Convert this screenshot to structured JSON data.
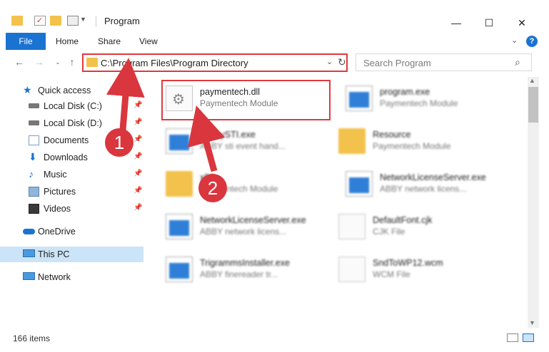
{
  "window": {
    "title": "Program"
  },
  "window_controls": {
    "minimize": "—",
    "maximize": "☐",
    "close": "✕"
  },
  "ribbon": {
    "tabs": [
      "File",
      "Home",
      "Share",
      "View"
    ],
    "help": "?"
  },
  "address_bar": {
    "path": "C:\\Program Files\\Program Directory"
  },
  "search": {
    "placeholder": "Search Program"
  },
  "sidebar": {
    "items": [
      {
        "label": "Quick access",
        "icon": "star-icon",
        "pinned": false
      },
      {
        "label": "Local Disk (C:)",
        "icon": "drive-icon",
        "pinned": true
      },
      {
        "label": "Local Disk (D:)",
        "icon": "drive-icon",
        "pinned": true
      },
      {
        "label": "Documents",
        "icon": "documents-icon",
        "pinned": true
      },
      {
        "label": "Downloads",
        "icon": "download-icon",
        "pinned": true
      },
      {
        "label": "Music",
        "icon": "music-icon",
        "pinned": true
      },
      {
        "label": "Pictures",
        "icon": "pictures-icon",
        "pinned": true
      },
      {
        "label": "Videos",
        "icon": "videos-icon",
        "pinned": true
      },
      {
        "label": "OneDrive",
        "icon": "cloud-icon",
        "pinned": false
      },
      {
        "label": "This PC",
        "icon": "computer-icon",
        "pinned": false,
        "selected": true
      },
      {
        "label": "Network",
        "icon": "network-icon",
        "pinned": false
      }
    ]
  },
  "files": [
    {
      "name": "paymentech.dll",
      "desc": "Paymentech Module",
      "type": "dll"
    },
    {
      "name": "program.exe",
      "desc": "Paymentech Module",
      "type": "exe"
    },
    {
      "name": "AbbyySTI.exe",
      "desc": "ABBY sti event hand...",
      "type": "exe"
    },
    {
      "name": "Resource",
      "desc": "Paymentech Module",
      "type": "folder"
    },
    {
      "name": "x86",
      "desc": "Paymentech Module",
      "type": "folder"
    },
    {
      "name": "NetworkLicenseServer.exe",
      "desc": "ABBY network licens...",
      "type": "exe"
    },
    {
      "name": "NetworkLicenseServer.exe",
      "desc": "ABBY network licens...",
      "type": "exe"
    },
    {
      "name": "DefaultFont.cjk",
      "desc": "CJK File",
      "type": "doc"
    },
    {
      "name": "TrigrammsInstaller.exe",
      "desc": "ABBY finereader tr...",
      "type": "exe"
    },
    {
      "name": "SndToWP12.wcm",
      "desc": "WCM File",
      "type": "doc"
    }
  ],
  "status": {
    "items_count": "166 items"
  },
  "callouts": {
    "step1": "1",
    "step2": "2"
  },
  "colors": {
    "accent": "#1a73d1",
    "highlight": "#e0393f",
    "badge": "#d9363e"
  }
}
